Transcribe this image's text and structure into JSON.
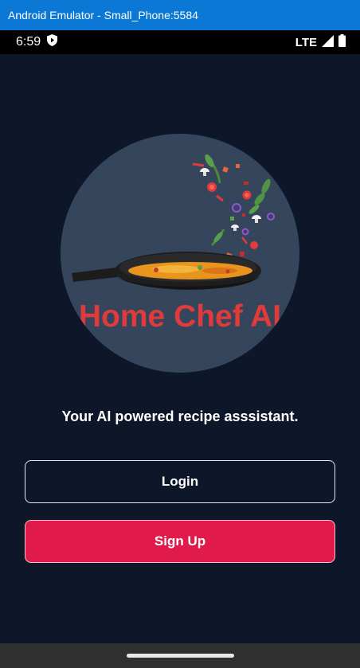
{
  "window": {
    "title": "Android Emulator - Small_Phone:5584"
  },
  "status_bar": {
    "time": "6:59",
    "network": "LTE",
    "icons": [
      "shield-icon",
      "signal-icon",
      "battery-icon"
    ]
  },
  "hero": {
    "brand": "Home Chef AI",
    "logo_icon": "frying-pan-with-vegetables"
  },
  "main": {
    "tagline": "Your AI powered recipe asssistant.",
    "login_label": "Login",
    "signup_label": "Sign Up"
  },
  "colors": {
    "background": "#0e1629",
    "circle": "#35465c",
    "brand_red": "#e03b3b",
    "signup_button": "#e01b4b",
    "titlebar": "#0a78d4"
  }
}
